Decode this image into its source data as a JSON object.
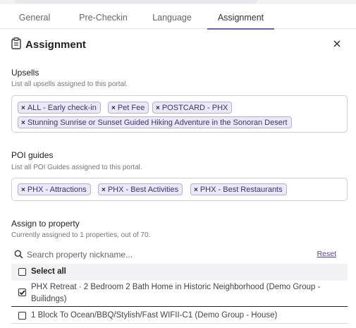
{
  "tabs": [
    {
      "label": "General"
    },
    {
      "label": "Pre-Checkin"
    },
    {
      "label": "Language"
    },
    {
      "label": "Assignment",
      "active": true
    }
  ],
  "header": {
    "title": "Assignment",
    "icon": "clipboard-icon",
    "close_icon": "close-icon"
  },
  "upsells": {
    "title": "Upsells",
    "subtitle": "List all upsells assigned to this portal.",
    "items": [
      "ALL - Early check-in",
      "Pet Fee",
      "POSTCARD - PHX",
      "Stunning Sunrise or Sunset Guided Hiking Adventure in the Sonoran Desert"
    ]
  },
  "poi": {
    "title": "POI guides",
    "subtitle": "List all POI Guides assigned to this portal.",
    "items": [
      "PHX - Attractions",
      "PHX - Best Activities",
      "PHX - Best Restaurants"
    ]
  },
  "property": {
    "title": "Assign to property",
    "subtitle": "Currently assigned to 1 properties, out of 70.",
    "search_placeholder": "Search property nickname...",
    "reset_label": "Reset",
    "select_all_label": "Select all",
    "rows": [
      {
        "label_line1": "PHX Retreat · 2 Bedroom 2 Bath Home in Historic Neighborhood (Demo Group -",
        "label_line2": "Builidngs)",
        "checked": true
      },
      {
        "label_line1": "1 Block To Ocean/BBQ/Stylish/Fast WIFII-C1 (Demo Group - House)",
        "checked": false
      }
    ]
  },
  "colors": {
    "accent": "#6b5fc7",
    "chip_bg": "#ebe8f7",
    "chip_border": "#b6addf",
    "link": "#4a3fa8"
  }
}
